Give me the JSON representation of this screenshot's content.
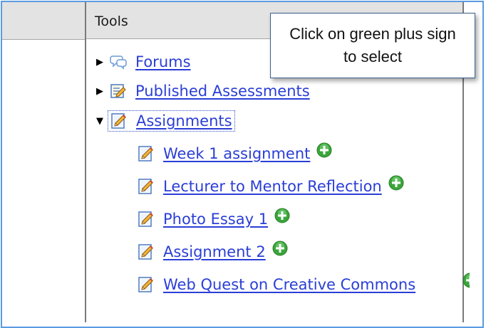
{
  "tools_panel": {
    "title": "Tools",
    "top_items": [
      {
        "label": "Forums",
        "icon": "forums-icon",
        "expanded": false
      },
      {
        "label": "Published Assessments",
        "icon": "published-assessments-icon",
        "expanded": false
      },
      {
        "label": "Assignments",
        "icon": "assignment-icon",
        "expanded": true
      }
    ],
    "assignments": [
      {
        "label": "Week 1 assignment"
      },
      {
        "label": "Lecturer to Mentor Reflection"
      },
      {
        "label": "Photo Essay 1"
      },
      {
        "label": "Assignment 2"
      },
      {
        "label": "Web Quest on Creative Commons"
      }
    ]
  },
  "callout": {
    "text": "Click on green plus sign to select"
  },
  "colors": {
    "link": "#2a3ed6",
    "header_bg": "#e3e3e3",
    "frame_border": "#5a9be0",
    "plus_green": "#3aa53a"
  }
}
